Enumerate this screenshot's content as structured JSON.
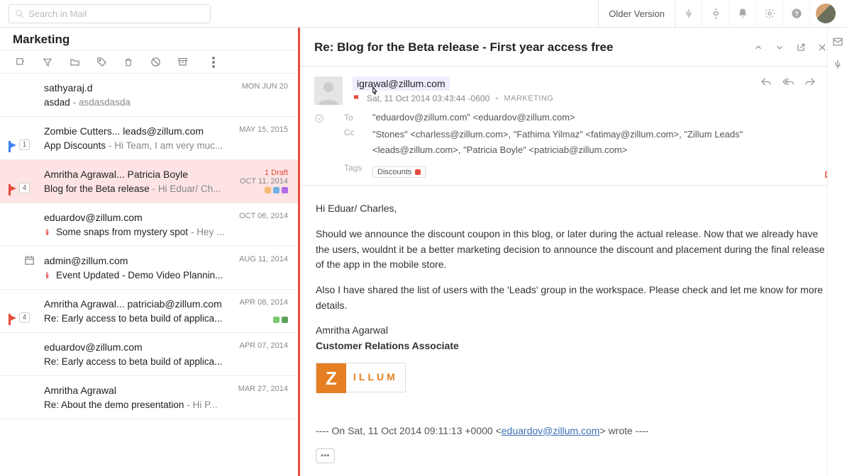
{
  "topbar": {
    "search_placeholder": "Search in Mail",
    "older_version": "Older Version"
  },
  "list": {
    "title": "Marketing",
    "items": [
      {
        "from": "sathyaraj.d",
        "subject": "asdad",
        "preview": " - asdasdasda",
        "date": "MON JUN 20",
        "draft": "",
        "flag": "",
        "count": "",
        "attach": false,
        "cal": false,
        "chips": []
      },
      {
        "from": "Zombie Cutters... leads@zillum.com",
        "subject": "App Discounts",
        "preview": " - Hi Team, I am very muc...",
        "date": "MAY 15, 2015",
        "draft": "",
        "flag": "blue",
        "count": "1",
        "attach": false,
        "cal": false,
        "chips": []
      },
      {
        "from": "Amritha Agrawal... Patricia Boyle",
        "subject": "Blog for the Beta release",
        "preview": " - Hi Eduar/ Ch...",
        "date": "OCT 11, 2014",
        "draft": "1 Draft",
        "flag": "red",
        "count": "4",
        "attach": false,
        "cal": false,
        "selected": true,
        "chips": [
          "#f5b971",
          "#6fb1e4",
          "#b26be8"
        ]
      },
      {
        "from": "eduardov@zillum.com",
        "subject": "Some snaps from mystery spot",
        "preview": " - Hey ...",
        "date": "OCT 06, 2014",
        "draft": "",
        "flag": "",
        "count": "",
        "attach": true,
        "cal": false,
        "chips": []
      },
      {
        "from": "admin@zillum.com",
        "subject": "Event Updated - Demo Video Plannin...",
        "preview": "",
        "date": "AUG 11, 2014",
        "draft": "",
        "flag": "",
        "count": "",
        "attach": true,
        "cal": true,
        "chips": []
      },
      {
        "from": "Amritha Agrawal... patriciab@zillum.com",
        "subject": "Re: Early access to beta build of applica...",
        "preview": "",
        "date": "APR 08, 2014",
        "draft": "",
        "flag": "red",
        "count": "4",
        "attach": false,
        "cal": false,
        "chips": [
          "#7bc96f",
          "#5ba35b"
        ]
      },
      {
        "from": "eduardov@zillum.com",
        "subject": "Re: Early access to beta build of applica...",
        "preview": "",
        "date": "APR 07, 2014",
        "draft": "",
        "flag": "",
        "count": "",
        "attach": false,
        "cal": false,
        "chips": []
      },
      {
        "from": "Amritha Agrawal",
        "subject": "Re: About the demo presentation",
        "preview": " - Hi P...",
        "date": "MAR 27, 2014",
        "draft": "",
        "flag": "",
        "count": "",
        "attach": false,
        "cal": false,
        "chips": []
      }
    ]
  },
  "read": {
    "subject": "Re: Blog for the Beta release - First year access free",
    "sender_email": "igrawal@zillum.com",
    "datetime": "Sat, 11 Oct 2014 03:43:44 -0600",
    "folder": "MARKETING",
    "to_label": "To",
    "to": "\"eduardov@zillum.com\" <eduardov@zillum.com>",
    "cc_label": "Cc",
    "cc": "\"Stones\" <charless@zillum.com>, \"Fathima Yilmaz\" <fatimay@zillum.com>, \"Zillum Leads\" <leads@zillum.com>, \"Patricia Boyle\" <patriciab@zillum.com>",
    "tags_label": "Tags",
    "tag_name": "Discounts",
    "body": {
      "greeting": "Hi Eduar/ Charles,",
      "p1": "Should we announce the discount coupon in this blog, or later during the actual release. Now that we already have the users, wouldnt it be a better marketing decision to announce the discount and placement during the final release of the app in the mobile store.",
      "p2": "Also I have shared the list of users with the 'Leads' group in the workspace. Please check and let me know for more details.",
      "sig_name": "Amritha Agarwal",
      "sig_title": "Customer Relations Associate",
      "logo_char": "Z",
      "logo_text": "ILLUM",
      "quoted_prefix": "---- On Sat, 11 Oct 2014 09:11:13 +0000 <",
      "quoted_email": "eduardov@zillum.com",
      "quoted_suffix": "> wrote ----"
    }
  }
}
